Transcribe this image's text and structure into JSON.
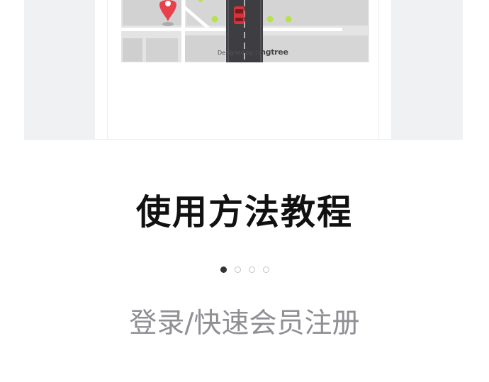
{
  "carousel": {
    "watermark_prefix": "Designed by",
    "watermark_brand": "pngtree",
    "pin_color": "#e8414c",
    "dot_color": "#b6e34a",
    "car_color": "#d8323c",
    "active_index": 0,
    "slide_count": 4
  },
  "title": "使用方法教程",
  "pager": {
    "dots": [
      "dot-1",
      "dot-2",
      "dot-3",
      "dot-4"
    ]
  },
  "login_link": "登录/快速会员注册"
}
